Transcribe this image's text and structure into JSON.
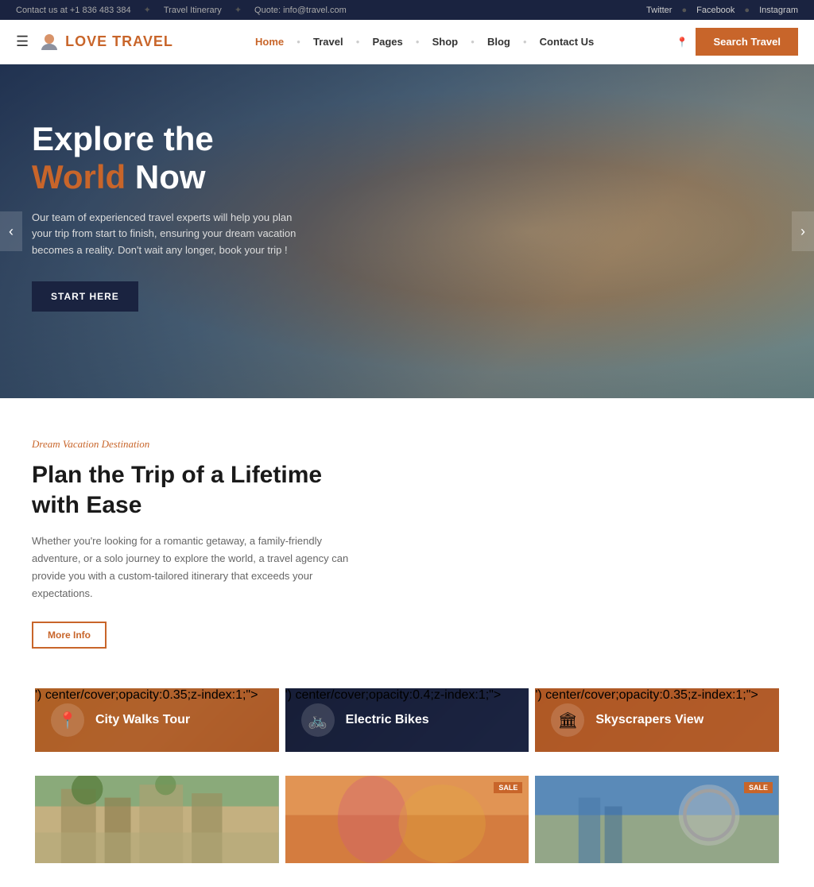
{
  "topbar": {
    "contact": "Contact us at +1 836 483 384",
    "itinerary": "Travel Itinerary",
    "quote": "Quote: info@travel.com",
    "twitter": "Twitter",
    "facebook": "Facebook",
    "instagram": "Instagram"
  },
  "header": {
    "logo_text_1": "LOVE",
    "logo_text_2": "TRAVEL",
    "nav": [
      {
        "label": "Home",
        "active": true
      },
      {
        "label": "Travel",
        "active": false
      },
      {
        "label": "Pages",
        "active": false
      },
      {
        "label": "Shop",
        "active": false
      },
      {
        "label": "Blog",
        "active": false
      },
      {
        "label": "Contact Us",
        "active": false
      }
    ],
    "search_btn": "Search Travel"
  },
  "hero": {
    "title_line1": "Explore the",
    "title_world": "World",
    "title_line2": "Now",
    "subtitle": "Our team of experienced travel experts will help you plan your trip from start to finish, ensuring your dream vacation becomes a reality. Don't wait any longer, book your trip !",
    "cta_btn": "START HERE"
  },
  "dream": {
    "tag": "Dream Vacation Destination",
    "title": "Plan the Trip of a Lifetime with Ease",
    "description": "Whether you're looking for a romantic getaway, a family-friendly adventure, or a solo journey to explore the world, a travel agency can provide you with a custom-tailored itinerary that exceeds your expectations.",
    "more_info_btn": "More Info"
  },
  "tour_cards": [
    {
      "label": "City Walks Tour",
      "icon": "📍",
      "color": "#c8652a"
    },
    {
      "label": "Electric Bikes",
      "icon": "🚲",
      "color": "#1a2340"
    },
    {
      "label": "Skyscrapers View",
      "icon": "🏛",
      "color": "#c8652a"
    }
  ],
  "photo_cards": [
    {
      "sale": false,
      "color1": "#7a9a6a",
      "color2": "#a8c4e8"
    },
    {
      "sale": true,
      "color1": "#c8652a",
      "color2": "#d4608a"
    },
    {
      "sale": true,
      "color1": "#5a8ab8",
      "color2": "#c8c8c8"
    }
  ],
  "sale_label": "SALE"
}
